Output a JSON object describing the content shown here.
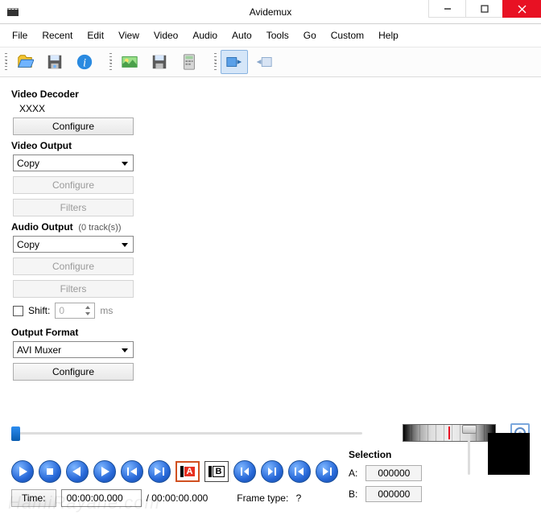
{
  "window": {
    "title": "Avidemux"
  },
  "menu": {
    "items": [
      "File",
      "Recent",
      "Edit",
      "View",
      "Video",
      "Audio",
      "Auto",
      "Tools",
      "Go",
      "Custom",
      "Help"
    ]
  },
  "toolbar": {
    "items": [
      {
        "name": "open-icon"
      },
      {
        "name": "save-icon"
      },
      {
        "name": "info-icon"
      },
      {
        "sep": true
      },
      {
        "name": "image-icon"
      },
      {
        "name": "save-video-icon"
      },
      {
        "name": "calculator-icon"
      },
      {
        "grip": true
      },
      {
        "name": "play-filtered-icon",
        "active": true
      },
      {
        "name": "play-output-icon"
      }
    ]
  },
  "video_decoder": {
    "title": "Video Decoder",
    "codec": "XXXX",
    "configure": "Configure"
  },
  "video_output": {
    "title": "Video Output",
    "selected": "Copy",
    "configure": "Configure",
    "filters": "Filters"
  },
  "audio_output": {
    "title": "Audio Output",
    "tracks": "(0 track(s))",
    "selected": "Copy",
    "configure": "Configure",
    "filters": "Filters",
    "shift_label": "Shift:",
    "shift_value": "0",
    "shift_unit": "ms"
  },
  "output_format": {
    "title": "Output Format",
    "selected": "AVI Muxer",
    "configure": "Configure"
  },
  "playback": {
    "time_label": "Time:",
    "time_value": "00:00:00.000",
    "duration": "/ 00:00:00.000",
    "frame_type_label": "Frame type:",
    "frame_type_value": "?",
    "mark_a": "A",
    "mark_b": "B"
  },
  "selection": {
    "title": "Selection",
    "a_label": "A:",
    "a_value": "000000",
    "b_label": "B:",
    "b_value": "000000"
  },
  "watermark": "HamiRayane.com"
}
